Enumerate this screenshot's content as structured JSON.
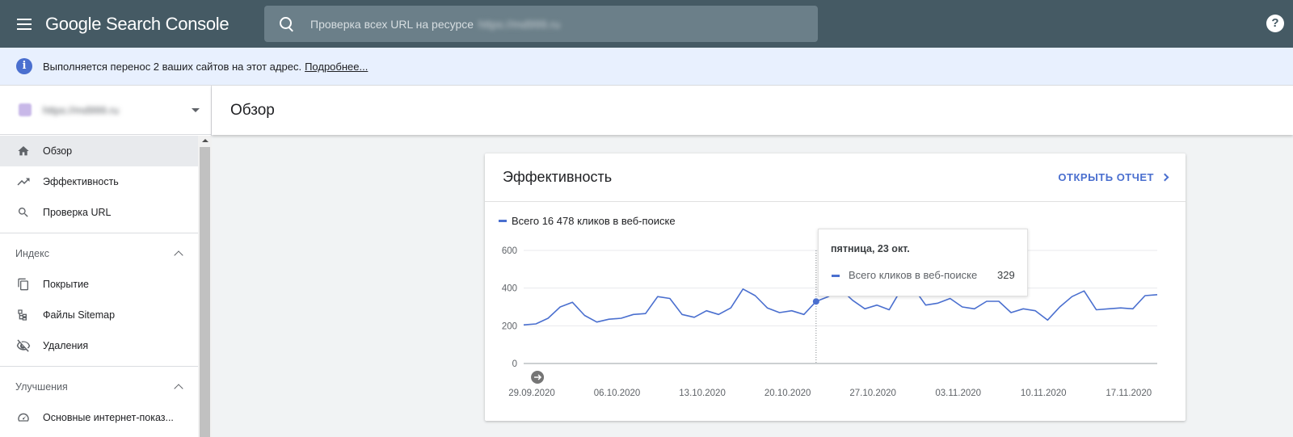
{
  "topbar": {
    "brand": "Google Search Console",
    "search_placeholder": "Проверка всех URL на ресурсе",
    "search_property": "https://md999.ru",
    "help_label": "?"
  },
  "banner": {
    "text": "Выполняется перенос 2 ваших сайтов на этот адрес.",
    "link": "Подробнее..."
  },
  "sidebar": {
    "property": "https://md999.ru",
    "items": [
      {
        "label": "Обзор",
        "icon": "home-icon"
      },
      {
        "label": "Эффективность",
        "icon": "trending-up-icon"
      },
      {
        "label": "Проверка URL",
        "icon": "search-icon"
      }
    ],
    "index_section": {
      "label": "Индекс",
      "items": [
        {
          "label": "Покрытие",
          "icon": "file-copy-icon"
        },
        {
          "label": "Файлы Sitemap",
          "icon": "sitemap-icon"
        },
        {
          "label": "Удаления",
          "icon": "visibility-off-icon"
        }
      ]
    },
    "enhancements_section": {
      "label": "Улучшения",
      "items": [
        {
          "label": "Основные интернет-показ...",
          "icon": "speed-icon"
        }
      ]
    }
  },
  "page": {
    "title": "Обзор"
  },
  "card": {
    "title": "Эффективность",
    "open_report": "ОТКРЫТЬ ОТЧЕТ",
    "legend": "Всего 16 478 кликов в веб-поиске",
    "tooltip": {
      "date": "пятница, 23 окт.",
      "label": "Всего кликов в веб-поиске",
      "value": "329"
    }
  },
  "colors": {
    "topbar": "#455a64",
    "accent": "#4a6fcf",
    "banner": "#e8f0fe"
  },
  "chart_data": {
    "type": "line",
    "series": [
      {
        "name": "Всего 16 478 кликов в веб-поиске",
        "values": [
          205,
          210,
          240,
          300,
          325,
          255,
          220,
          235,
          240,
          260,
          265,
          355,
          345,
          260,
          245,
          280,
          260,
          295,
          395,
          360,
          295,
          270,
          280,
          260,
          329,
          355,
          395,
          335,
          290,
          310,
          285,
          395,
          400,
          310,
          320,
          345,
          300,
          290,
          330,
          330,
          270,
          290,
          280,
          230,
          300,
          355,
          385,
          285,
          290,
          295,
          290,
          360,
          365
        ]
      }
    ],
    "x_start": "2020-09-29",
    "x_ticks": [
      "29.09.2020",
      "06.10.2020",
      "13.10.2020",
      "20.10.2020",
      "27.10.2020",
      "03.11.2020",
      "10.11.2020",
      "17.11.2020"
    ],
    "y_ticks": [
      0,
      200,
      400,
      600
    ],
    "ylim": [
      0,
      600
    ],
    "highlight_index": 24,
    "grid": true
  }
}
